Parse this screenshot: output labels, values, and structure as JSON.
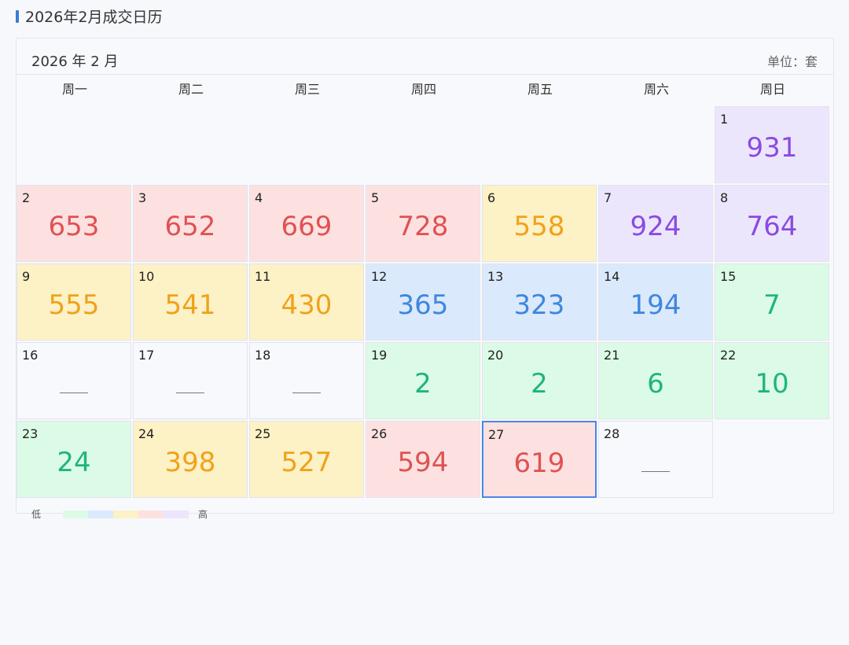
{
  "page": {
    "title": "2026年2月成交日历"
  },
  "calendar": {
    "month_label": "2026 年 2 月",
    "unit_label": "单位：套",
    "weekdays": [
      "周一",
      "周二",
      "周三",
      "周四",
      "周五",
      "周六",
      "周日"
    ],
    "selected_day": 27,
    "days": [
      {
        "day": 1,
        "value": "931",
        "level": "purple"
      },
      {
        "day": 2,
        "value": "653",
        "level": "red"
      },
      {
        "day": 3,
        "value": "652",
        "level": "red"
      },
      {
        "day": 4,
        "value": "669",
        "level": "red"
      },
      {
        "day": 5,
        "value": "728",
        "level": "red"
      },
      {
        "day": 6,
        "value": "558",
        "level": "yellow"
      },
      {
        "day": 7,
        "value": "924",
        "level": "purple"
      },
      {
        "day": 8,
        "value": "764",
        "level": "purple"
      },
      {
        "day": 9,
        "value": "555",
        "level": "yellow"
      },
      {
        "day": 10,
        "value": "541",
        "level": "yellow"
      },
      {
        "day": 11,
        "value": "430",
        "level": "yellow"
      },
      {
        "day": 12,
        "value": "365",
        "level": "blue"
      },
      {
        "day": 13,
        "value": "323",
        "level": "blue"
      },
      {
        "day": 14,
        "value": "194",
        "level": "blue"
      },
      {
        "day": 15,
        "value": "7",
        "level": "green"
      },
      {
        "day": 16,
        "value": null,
        "level": "none"
      },
      {
        "day": 17,
        "value": null,
        "level": "none"
      },
      {
        "day": 18,
        "value": null,
        "level": "none"
      },
      {
        "day": 19,
        "value": "2",
        "level": "green"
      },
      {
        "day": 20,
        "value": "2",
        "level": "green"
      },
      {
        "day": 21,
        "value": "6",
        "level": "green"
      },
      {
        "day": 22,
        "value": "10",
        "level": "green"
      },
      {
        "day": 23,
        "value": "24",
        "level": "green"
      },
      {
        "day": 24,
        "value": "398",
        "level": "yellow"
      },
      {
        "day": 25,
        "value": "527",
        "level": "yellow"
      },
      {
        "day": 26,
        "value": "594",
        "level": "red"
      },
      {
        "day": 27,
        "value": "619",
        "level": "red"
      },
      {
        "day": 28,
        "value": null,
        "level": "none"
      }
    ]
  },
  "legend": {
    "low_label": "低",
    "high_label": "高",
    "colors": [
      "#dcfbe6",
      "#dbe9fc",
      "#fdf1c6",
      "#fde1e1",
      "#ece6fd"
    ]
  },
  "colors": {
    "accent": "#3a7bd5",
    "selected_border": "#4a86e8"
  }
}
